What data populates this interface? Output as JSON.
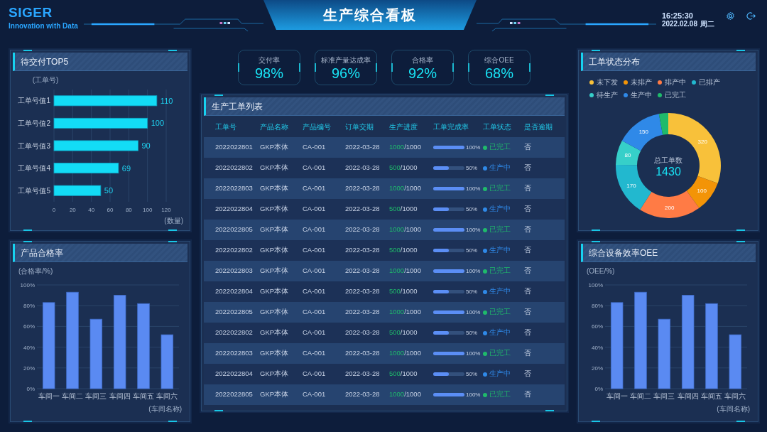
{
  "header": {
    "logo": "SIGER",
    "tagline": "Innovation with Data",
    "title": "生产综合看板",
    "time": "16:25:30",
    "date": "2022.02.08",
    "weekday": "周二"
  },
  "kpis": [
    {
      "label": "交付率",
      "value": "98%"
    },
    {
      "label": "标准产量达成率",
      "value": "96%"
    },
    {
      "label": "合格率",
      "value": "92%"
    },
    {
      "label": "综合OEE",
      "value": "68%"
    }
  ],
  "pending_top5": {
    "title": "待交付TOP5",
    "chart_data": {
      "type": "bar",
      "orientation": "horizontal",
      "ylabel": "(工单号)",
      "xlabel": "(数量)",
      "categories": [
        "工单号值1",
        "工单号值2",
        "工单号值3",
        "工单号值4",
        "工单号值5"
      ],
      "values": [
        110,
        100,
        90,
        69,
        50
      ],
      "grid": true,
      "xlim": [
        0,
        120
      ],
      "xticks": [
        0,
        20,
        40,
        60,
        80,
        100,
        120
      ],
      "data_labels": true
    }
  },
  "quality_rate": {
    "title": "产品合格率",
    "chart_data": {
      "type": "bar",
      "ylabel": "(合格率/%)",
      "xlabel": "(车间名称)",
      "categories": [
        "车间一",
        "车间二",
        "车间三",
        "车间四",
        "车间五",
        "车间六"
      ],
      "values": [
        83,
        93,
        67,
        90,
        82,
        52
      ],
      "grid": true,
      "ylim": [
        0,
        100
      ],
      "yticks": [
        {
          "value": 0,
          "label": "0%"
        },
        {
          "value": 20,
          "label": "20%"
        },
        {
          "value": 40,
          "label": "40%"
        },
        {
          "value": 60,
          "label": "60%"
        },
        {
          "value": 80,
          "label": "80%"
        },
        {
          "value": 100,
          "label": "100%"
        }
      ]
    }
  },
  "work_orders": {
    "title": "生产工单列表",
    "columns": [
      "工单号",
      "产品名称",
      "产品编号",
      "订单交期",
      "生产进度",
      "工单完成率",
      "工单状态",
      "是否逾期"
    ],
    "rows": [
      {
        "order_no": "2022022801",
        "product_name": "GKP本体",
        "product_code": "CA-001",
        "due_date": "2022-03-28",
        "produced": "1000",
        "target": "/1000",
        "level": 1,
        "rate": "100%",
        "status": "已完工",
        "color": "#1fba6b",
        "overdue": "否"
      },
      {
        "order_no": "2022022802",
        "product_name": "GKP本体",
        "product_code": "CA-001",
        "due_date": "2022-03-28",
        "produced": "500",
        "target": "/1000",
        "level": 0.5,
        "rate": "50%",
        "status": "生产中",
        "color": "#2f89e8",
        "overdue": "否"
      },
      {
        "order_no": "2022022803",
        "product_name": "GKP本体",
        "product_code": "CA-001",
        "due_date": "2022-03-28",
        "produced": "1000",
        "target": "/1000",
        "level": 1,
        "rate": "100%",
        "status": "已完工",
        "color": "#1fba6b",
        "overdue": "否"
      },
      {
        "order_no": "2022022804",
        "product_name": "GKP本体",
        "product_code": "CA-001",
        "due_date": "2022-03-28",
        "produced": "500",
        "target": "/1000",
        "level": 0.5,
        "rate": "50%",
        "status": "生产中",
        "color": "#2f89e8",
        "overdue": "否"
      },
      {
        "order_no": "2022022805",
        "product_name": "GKP本体",
        "product_code": "CA-001",
        "due_date": "2022-03-28",
        "produced": "1000",
        "target": "/1000",
        "level": 1,
        "rate": "100%",
        "status": "已完工",
        "color": "#1fba6b",
        "overdue": "否"
      },
      {
        "order_no": "2022022802",
        "product_name": "GKP本体",
        "product_code": "CA-001",
        "due_date": "2022-03-28",
        "produced": "500",
        "target": "/1000",
        "level": 0.5,
        "rate": "50%",
        "status": "生产中",
        "color": "#2f89e8",
        "overdue": "否"
      },
      {
        "order_no": "2022022803",
        "product_name": "GKP本体",
        "product_code": "CA-001",
        "due_date": "2022-03-28",
        "produced": "1000",
        "target": "/1000",
        "level": 1,
        "rate": "100%",
        "status": "已完工",
        "color": "#1fba6b",
        "overdue": "否"
      },
      {
        "order_no": "2022022804",
        "product_name": "GKP本体",
        "product_code": "CA-001",
        "due_date": "2022-03-28",
        "produced": "500",
        "target": "/1000",
        "level": 0.5,
        "rate": "50%",
        "status": "生产中",
        "color": "#2f89e8",
        "overdue": "否"
      },
      {
        "order_no": "2022022805",
        "product_name": "GKP本体",
        "product_code": "CA-001",
        "due_date": "2022-03-28",
        "produced": "1000",
        "target": "/1000",
        "level": 1,
        "rate": "100%",
        "status": "已完工",
        "color": "#1fba6b",
        "overdue": "否"
      },
      {
        "order_no": "2022022802",
        "product_name": "GKP本体",
        "product_code": "CA-001",
        "due_date": "2022-03-28",
        "produced": "500",
        "target": "/1000",
        "level": 0.5,
        "rate": "50%",
        "status": "生产中",
        "color": "#2f89e8",
        "overdue": "否"
      },
      {
        "order_no": "2022022803",
        "product_name": "GKP本体",
        "product_code": "CA-001",
        "due_date": "2022-03-28",
        "produced": "1000",
        "target": "/1000",
        "level": 1,
        "rate": "100%",
        "status": "已完工",
        "color": "#1fba6b",
        "overdue": "否"
      },
      {
        "order_no": "2022022804",
        "product_name": "GKP本体",
        "product_code": "CA-001",
        "due_date": "2022-03-28",
        "produced": "500",
        "target": "/1000",
        "level": 0.5,
        "rate": "50%",
        "status": "生产中",
        "color": "#2f89e8",
        "overdue": "否"
      },
      {
        "order_no": "2022022805",
        "product_name": "GKP本体",
        "product_code": "CA-001",
        "due_date": "2022-03-28",
        "produced": "1000",
        "target": "/1000",
        "level": 1,
        "rate": "100%",
        "status": "已完工",
        "color": "#1fba6b",
        "overdue": "否"
      }
    ]
  },
  "status_distribution": {
    "title": "工单状态分布",
    "total_label": "总工单数",
    "total_value": "1430",
    "chart_data": {
      "type": "donut",
      "value_labels": [
        "320",
        "100",
        "200",
        "170",
        "80",
        "150",
        null
      ],
      "categories": [
        "未下发",
        "未排产",
        "排产中",
        "已排产",
        "待生产",
        "生产中",
        "已完工"
      ],
      "values": [
        320,
        100,
        200,
        170,
        80,
        150,
        30
      ],
      "colors": [
        "#f8c13a",
        "#f39407",
        "#ff7b45",
        "#22b8cf",
        "#36cfc9",
        "#2f89e8",
        "#1fba6b"
      ]
    }
  },
  "oee": {
    "title": "综合设备效率OEE",
    "chart_data": {
      "type": "bar",
      "ylabel": "(OEE/%)",
      "xlabel": "(车间名称)",
      "categories": [
        "车间一",
        "车间二",
        "车间三",
        "车间四",
        "车间五",
        "车间六"
      ],
      "values": [
        83,
        93,
        67,
        90,
        82,
        52
      ],
      "grid": true,
      "ylim": [
        0,
        100
      ],
      "yticks": [
        {
          "value": 0,
          "label": "0%"
        },
        {
          "value": 20,
          "label": "20%"
        },
        {
          "value": 40,
          "label": "40%"
        },
        {
          "value": 60,
          "label": "60%"
        },
        {
          "value": 80,
          "label": "80%"
        },
        {
          "value": 100,
          "label": "100%"
        }
      ]
    }
  }
}
